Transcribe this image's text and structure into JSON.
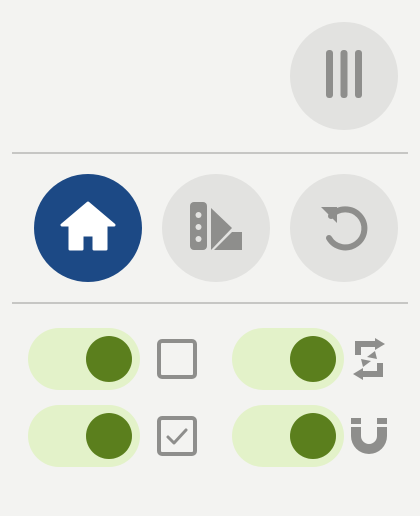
{
  "colors": {
    "background": "#f3f3f1",
    "button_bg": "#e2e2e0",
    "active_button_bg": "#1c4985",
    "icon_gray": "#8e8e8c",
    "toggle_track": "#e3f2c9",
    "toggle_knob": "#5b7f1d"
  },
  "top_bar": {
    "menu_button": {
      "icon": "column-menu-icon"
    }
  },
  "mode_buttons": [
    {
      "id": "home",
      "icon": "home-icon",
      "active": true
    },
    {
      "id": "palette",
      "icon": "swatch-palette-icon",
      "active": false
    },
    {
      "id": "reset",
      "icon": "rotate-ccw-icon",
      "active": false
    }
  ],
  "toggles": [
    {
      "id": "toggle-1",
      "state": "on",
      "side_icon": "checkbox-empty-icon"
    },
    {
      "id": "toggle-2",
      "state": "on",
      "side_icon": "autorenew-icon"
    },
    {
      "id": "toggle-3",
      "state": "on",
      "side_icon": "checkbox-checked-icon"
    },
    {
      "id": "toggle-4",
      "state": "on",
      "side_icon": "magnet-icon"
    }
  ]
}
